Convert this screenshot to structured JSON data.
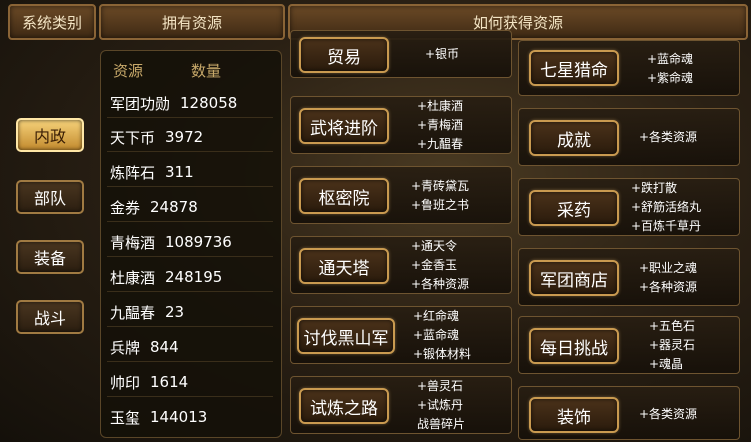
{
  "headers": {
    "category": "系统类别",
    "owned": "拥有资源",
    "how_to_get": "如何获得资源"
  },
  "tabs": [
    {
      "label": "内政",
      "active": true
    },
    {
      "label": "部队",
      "active": false
    },
    {
      "label": "装备",
      "active": false
    },
    {
      "label": "战斗",
      "active": false
    }
  ],
  "resources": {
    "col_name": "资源",
    "col_count": "数量",
    "items": [
      {
        "name": "军团功勋",
        "value": "128058"
      },
      {
        "name": "天下币",
        "value": "3972"
      },
      {
        "name": "炼阵石",
        "value": "311"
      },
      {
        "name": "金券",
        "value": "24878"
      },
      {
        "name": "青梅酒",
        "value": "1089736"
      },
      {
        "name": "杜康酒",
        "value": "248195"
      },
      {
        "name": "九醖春",
        "value": "23"
      },
      {
        "name": "兵牌",
        "value": "844"
      },
      {
        "name": "帅印",
        "value": "1614"
      },
      {
        "name": "玉玺",
        "value": "144013"
      }
    ]
  },
  "sources_left": [
    {
      "name": "贸易",
      "rewards": [
        "+银币"
      ]
    },
    {
      "name": "武将进阶",
      "rewards": [
        "+杜康酒",
        "+青梅酒",
        "+九醖春"
      ]
    },
    {
      "name": "枢密院",
      "rewards": [
        "+青砖黛瓦",
        "+鲁班之书"
      ]
    },
    {
      "name": "通天塔",
      "rewards": [
        "+通天令",
        "+金香玉",
        "+各种资源"
      ]
    },
    {
      "name": "讨伐黑山军",
      "rewards": [
        "+红命魂",
        "+蓝命魂",
        "+锻体材料"
      ]
    },
    {
      "name": "试炼之路",
      "rewards": [
        "+兽灵石",
        "+试炼丹",
        "战兽碎片"
      ]
    }
  ],
  "sources_right": [
    {
      "name": "七星猎命",
      "rewards": [
        "+蓝命魂",
        "+紫命魂"
      ]
    },
    {
      "name": "成就",
      "rewards": [
        "+各类资源"
      ]
    },
    {
      "name": "采药",
      "rewards": [
        "+跌打散",
        "+舒筋活络丸",
        "+百炼千草丹"
      ]
    },
    {
      "name": "军团商店",
      "rewards": [
        "+职业之魂",
        "+各种资源"
      ]
    },
    {
      "name": "每日挑战",
      "rewards": [
        "+五色石",
        "+器灵石",
        "+魂晶"
      ]
    },
    {
      "name": "装饰",
      "rewards": [
        "+各类资源"
      ]
    }
  ]
}
